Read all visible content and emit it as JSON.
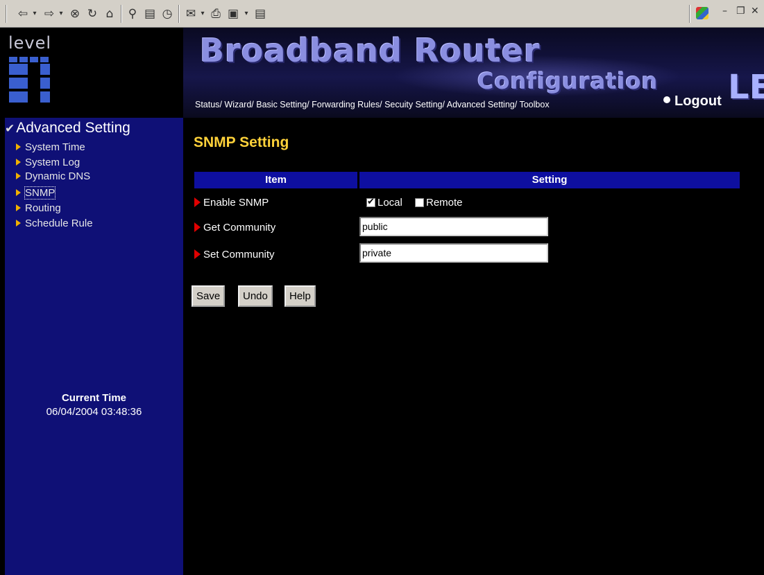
{
  "browser": {
    "icons": [
      "back-arrow-icon",
      "dropdown-icon",
      "forward-arrow-icon",
      "dropdown-icon",
      "stop-icon",
      "refresh-icon",
      "home-icon",
      "search-icon",
      "favorites-icon",
      "history-icon",
      "mail-icon",
      "print-icon",
      "edit-icon",
      "dropdown-icon",
      "discuss-icon"
    ],
    "controls": [
      "–",
      "❐",
      "✕"
    ]
  },
  "brand": {
    "text": "level"
  },
  "banner": {
    "title": "Broadband Router",
    "subtitle": "Configuration",
    "logo": "LE",
    "nav": [
      "Status",
      "Wizard",
      "Basic Setting",
      "Forwarding Rules",
      "Secuity Setting",
      "Advanced Setting",
      "Toolbox"
    ],
    "logout": "Logout"
  },
  "sidebar": {
    "section": "Advanced Setting",
    "items": [
      {
        "label": "System Time"
      },
      {
        "label": "System Log"
      },
      {
        "label": "Dynamic DNS"
      },
      {
        "label": "SNMP"
      },
      {
        "label": "Routing"
      },
      {
        "label": "Schedule Rule"
      }
    ],
    "time_title": "Current Time",
    "time_value": "06/04/2004 03:48:36"
  },
  "main": {
    "title": "SNMP Setting",
    "headers": {
      "item": "Item",
      "setting": "Setting"
    },
    "rows": {
      "enable": {
        "label": "Enable SNMP",
        "local": "Local",
        "local_checked": true,
        "remote": "Remote",
        "remote_checked": false
      },
      "get": {
        "label": "Get Community",
        "value": "public"
      },
      "set": {
        "label": "Set Community",
        "value": "private"
      }
    },
    "buttons": {
      "save": "Save",
      "undo": "Undo",
      "help": "Help"
    }
  }
}
